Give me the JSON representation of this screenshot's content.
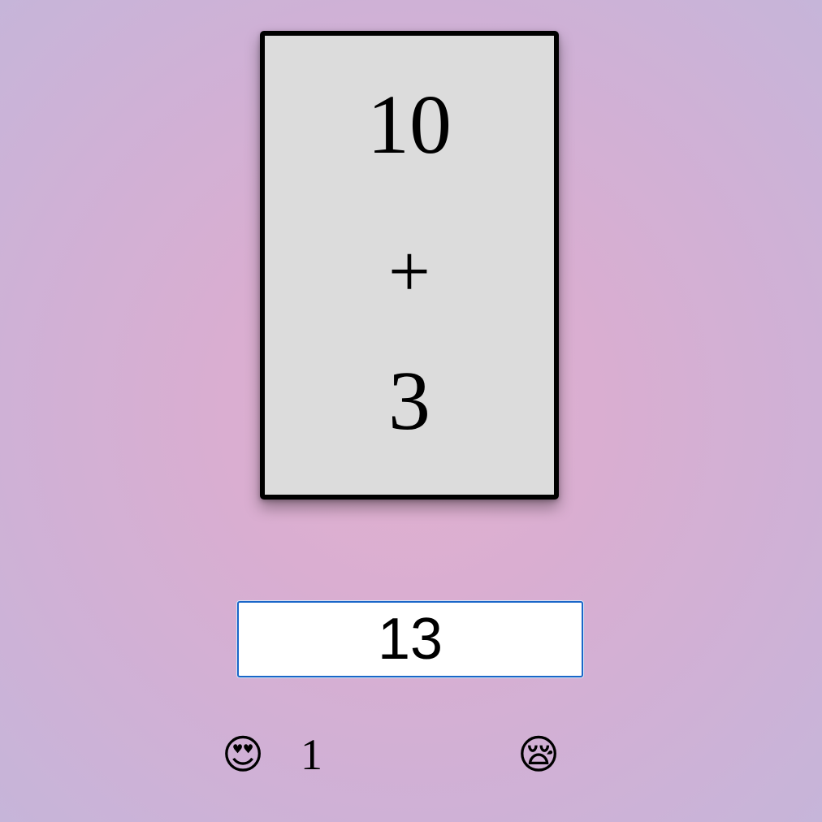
{
  "card": {
    "top_number": "10",
    "operator": "+",
    "bottom_number": "3"
  },
  "answer": {
    "value": "13"
  },
  "score": {
    "correct_icon": "😍",
    "correct_icon_name": "star-struck-emoji",
    "correct_count": "1",
    "wrong_icon": "😪",
    "wrong_icon_name": "sleepy-emoji",
    "wrong_count": ""
  },
  "colors": {
    "card_background": "#dcdcdc",
    "card_border": "#000000",
    "input_border": "#1a66c8",
    "background_center": "#e2b1d0",
    "background_edge": "#c6b5d9"
  }
}
